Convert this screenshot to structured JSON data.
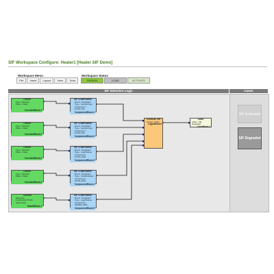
{
  "title": "SIF Workspace Configure: Heater1 [Heater SIF Demo]",
  "workspace_menu": {
    "label": "Workspace Menu",
    "items": [
      "File",
      "Insert",
      "Layout",
      "View",
      "Tools"
    ]
  },
  "workspace_status": {
    "label": "Workspace Status",
    "design": "DESIGN",
    "load": "LOAD",
    "activate": "ACTIVATE"
  },
  "panels": {
    "logic_title": "SIF Selection Logic",
    "cases_title": "Cases"
  },
  "constants": [
    {
      "header": "CONST",
      "row1": "Type : Boolean",
      "row2": "Value : False",
      "label": "ConstantBlock.1"
    },
    {
      "header": "CONST",
      "row1": "Type : Boolean",
      "row2": "Value : False",
      "label": "ConstantBlock.2"
    },
    {
      "header": "CONST",
      "row1": "Type : Boolean",
      "row2": "Value : False",
      "label": "ConstantBlock.3"
    },
    {
      "header": "CONST",
      "row1": "Type : Boolean",
      "row2": "Value : False",
      "label": "ConstantBlock.4"
    }
  ],
  "datain": {
    "header": "DATAIN",
    "row1": "Data Item : LC01CU01.PT100",
    "row2": "Value Field",
    "label": "DataInBlock.1"
  },
  "components": [
    {
      "header": "SIF COMPONENT",
      "row1": "Event : Degraded",
      "row2": "Type : Sensor/Input",
      "row3": "Component : PT101_BS",
      "label": "ComponentBlock.1"
    },
    {
      "header": "SIF COMPONENT",
      "row1": "Event : Degraded",
      "row2": "Type : Sensor/Input",
      "row3": "Component : PT102_BS",
      "label": "ComponentBlock.2"
    },
    {
      "header": "SIF COMPONENT",
      "row1": "Event : Degraded",
      "row2": "Type : Logic/Solver",
      "row3": "Component : PT101_BS3",
      "label": "ComponentBlock.3"
    },
    {
      "header": "SIF COMPONENT",
      "row1": "Event : Degraded",
      "row2": "Type : Final/Actuator",
      "row3": "Component : ZT101_BS3",
      "label": "ComponentBlock.4"
    },
    {
      "header": "SIF COMPONENT",
      "row1": "Event : Degraded",
      "row2": "Type : Logic/Solver",
      "row3": "Component : CR2001_BS3",
      "label": "ComponentBlock.5"
    }
  ],
  "logic": {
    "header": "LOGICAL OR",
    "row1": "Output : False",
    "label": "LogicBlock.6"
  },
  "case_block": {
    "header": "CASE",
    "row1": "Label : SIF Degraded",
    "label": "CaseBlock.1"
  },
  "cases": {
    "activated": "SIF Activated",
    "degraded": "SIF Degraded"
  }
}
